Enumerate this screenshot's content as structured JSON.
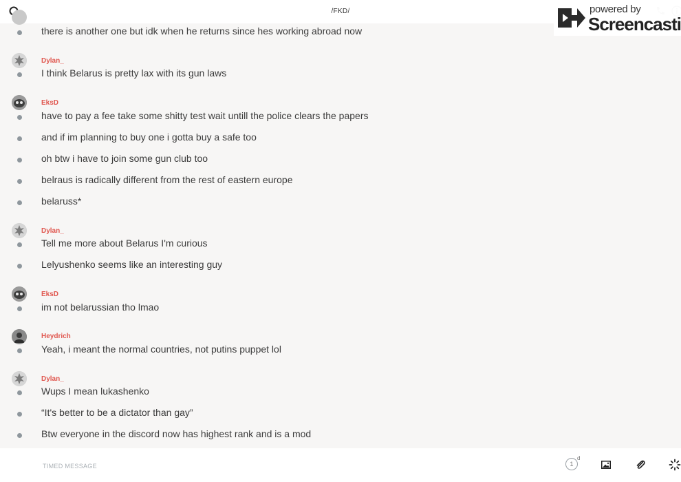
{
  "header": {
    "room_title": "/FKD/"
  },
  "watermark": {
    "powered": "powered by",
    "brand": "Screencastify"
  },
  "messages": {
    "g0": {
      "lines": [
        "there is another one but idk when he returns since hes working abroad now"
      ]
    },
    "g1": {
      "username": "Dylan_",
      "lines": [
        "I think Belarus is pretty lax with its gun laws"
      ]
    },
    "g2": {
      "username": "EksD",
      "lines": [
        "have to pay a fee take some shitty test wait untill the police clears the papers",
        "and if im planning to buy one i gotta buy a safe too",
        "oh btw i have to join some gun club too",
        "belraus is radically different from the rest of eastern europe",
        "belaruss*"
      ]
    },
    "g3": {
      "username": "Dylan_",
      "lines": [
        "Tell me more about Belarus I'm curious",
        "Lelyushenko seems like an interesting guy"
      ]
    },
    "g4": {
      "username": "EksD",
      "lines": [
        "im not belarussian tho lmao"
      ]
    },
    "g5": {
      "username": "Heydrich",
      "lines": [
        "Yeah, i meant the normal countries, not putins puppet lol"
      ]
    },
    "g6": {
      "username": "Dylan_",
      "lines": [
        "Wups I mean lukashenko",
        "“It's better to be a dictator than gay”",
        "Btw everyone in the discord now has highest rank and is a mod"
      ]
    }
  },
  "composer": {
    "placeholder": "TIMED MESSAGE",
    "timer_value": "1",
    "timer_unit": "d"
  },
  "colors": {
    "username": "#e0574f",
    "background": "#f7f6f5",
    "dot": "#8f979d"
  }
}
